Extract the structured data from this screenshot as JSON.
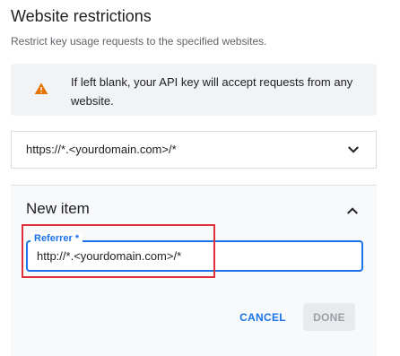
{
  "section": {
    "title": "Website restrictions",
    "subtitle": "Restrict key usage requests to the specified websites."
  },
  "warning": {
    "icon": "warning-icon",
    "icon_color": "#e37400",
    "text": "If left blank, your API key will accept requests from any website."
  },
  "existing_item": {
    "value": "https://*.<yourdomain.com>/*",
    "icon": "chevron-down-icon"
  },
  "new_item": {
    "title": "New item",
    "collapse_icon": "chevron-up-icon",
    "field_label": "Referrer *",
    "field_value": "http://*.<yourdomain.com>/*",
    "accent_color": "#1a73e8",
    "cancel_label": "CANCEL",
    "done_label": "DONE"
  },
  "highlight": {
    "color": "#e0313a"
  }
}
